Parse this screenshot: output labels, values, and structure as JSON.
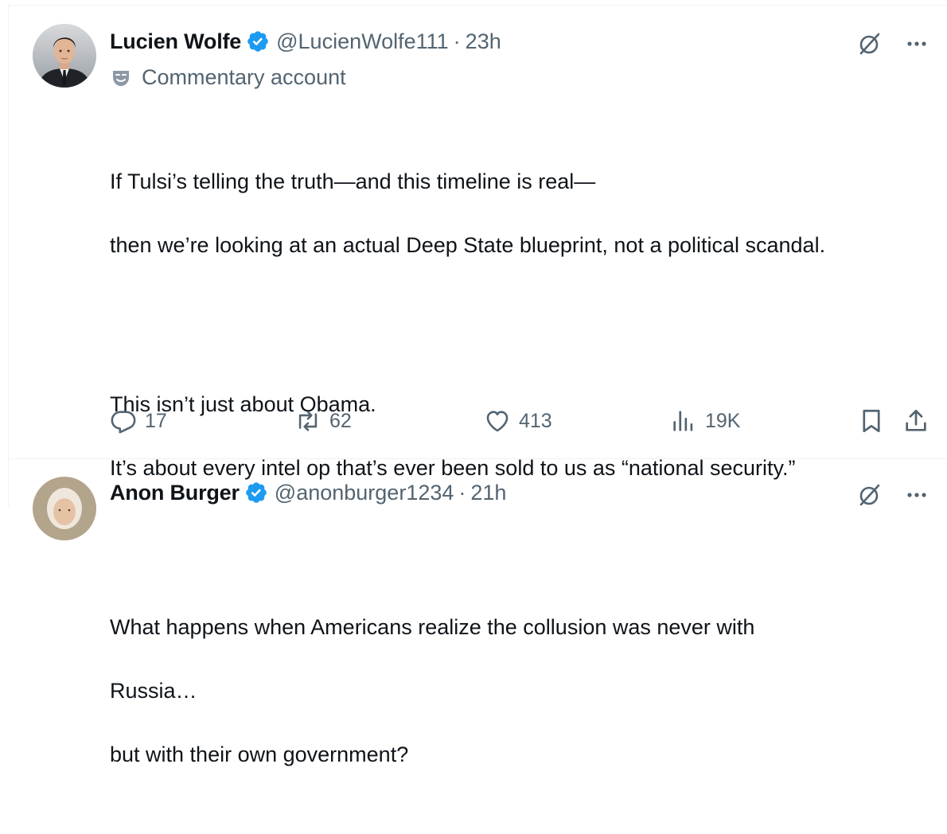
{
  "post1": {
    "author_name": "Lucien Wolfe",
    "handle": "@LucienWolfe111",
    "separator": "·",
    "time": "23h",
    "badge_label": "Commentary account",
    "text_paragraphs": [
      [
        "If Tulsi’s telling the truth—and this timeline is real—",
        "then we’re looking at an actual Deep State blueprint, not a political scandal."
      ],
      [
        "This isn’t just about Obama.",
        "It’s about every intel op that’s ever been sold to us as “national security.”"
      ],
      [
        "What happens when Americans realize the collusion was never with",
        "Russia…",
        "but with their own government?"
      ]
    ],
    "actions": {
      "replies": "17",
      "reposts": "62",
      "likes": "413",
      "views": "19K"
    }
  },
  "post2": {
    "author_name": "Anon Burger",
    "handle": "@anonburger1234",
    "separator": "·",
    "time": "21h"
  },
  "colors": {
    "text": "#0f1419",
    "secondary": "#536471",
    "verified": "#1d9bf0",
    "border": "#eff3f4"
  },
  "icons": {
    "verified": "verified-badge-icon",
    "grok": "grok-icon",
    "more": "more-icon",
    "commentary": "comedy-mask-icon",
    "reply": "reply-icon",
    "repost": "repost-icon",
    "like": "heart-icon",
    "views": "views-icon",
    "bookmark": "bookmark-icon",
    "share": "share-icon"
  }
}
